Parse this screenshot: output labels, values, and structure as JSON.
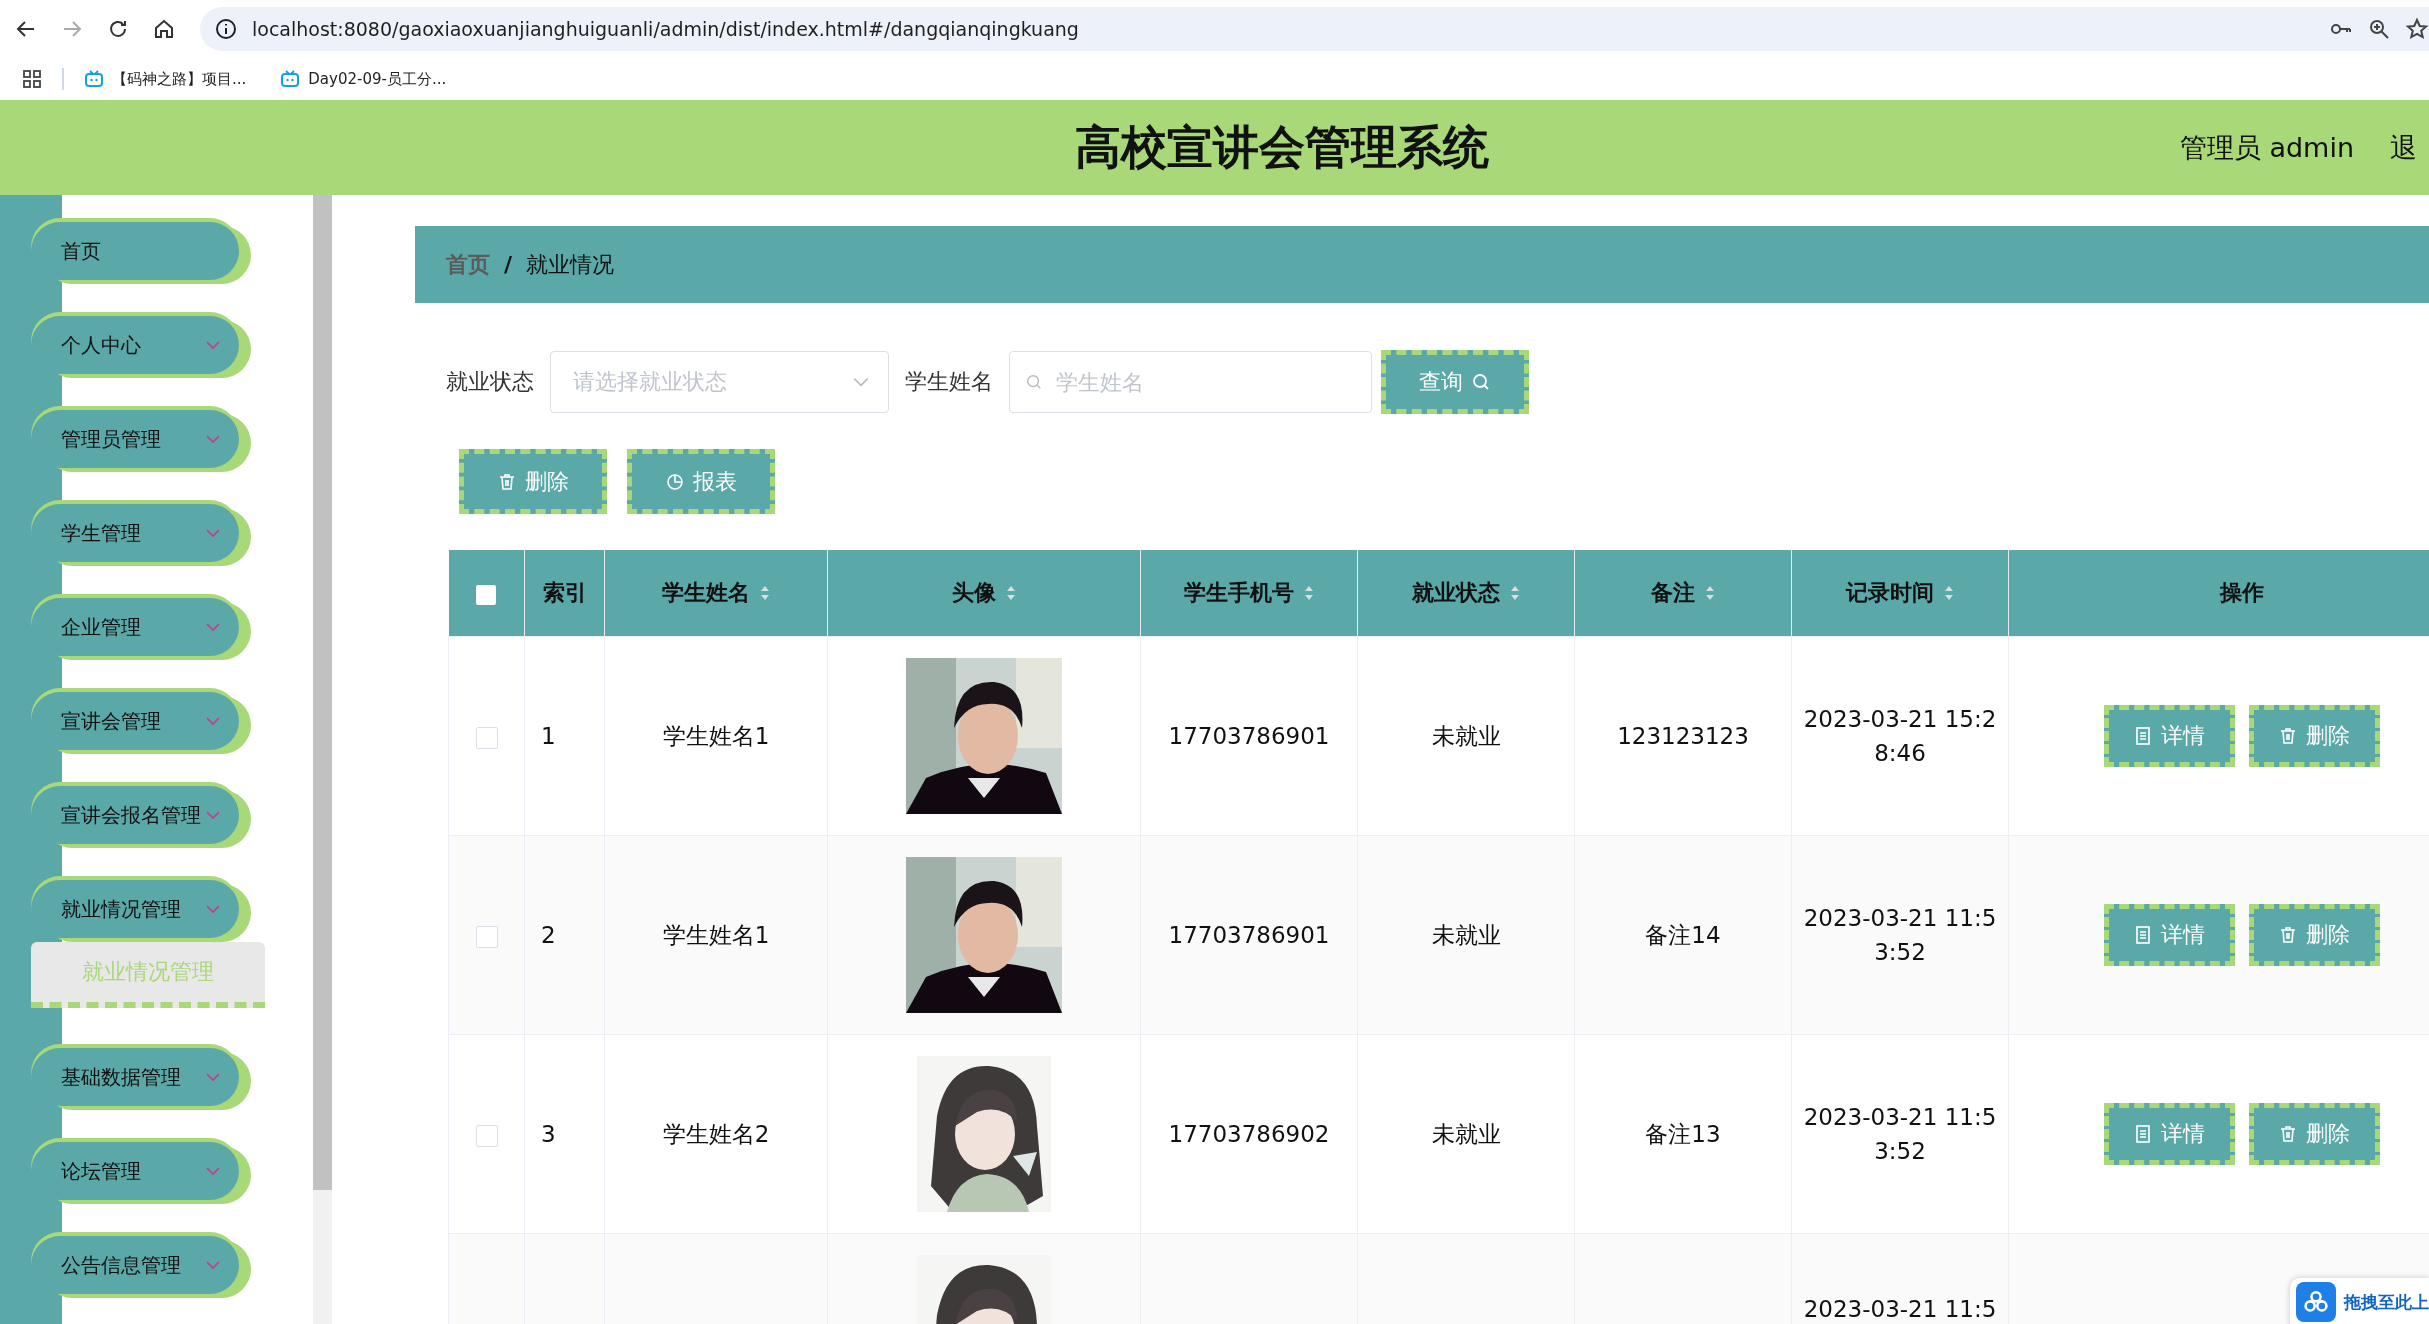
{
  "browser": {
    "url": "localhost:8080/gaoxiaoxuanjianghuiguanli/admin/dist/index.html#/dangqianqingkuang",
    "bookmarks": [
      "【码神之路】项目...",
      "Day02-09-员工分..."
    ]
  },
  "header": {
    "title": "高校宣讲会管理系统",
    "user": "管理员 admin",
    "logout": "退"
  },
  "sidebar": {
    "items": [
      {
        "label": "首页",
        "kind": "link"
      },
      {
        "label": "个人中心",
        "kind": "group"
      },
      {
        "label": "管理员管理",
        "kind": "group"
      },
      {
        "label": "学生管理",
        "kind": "group"
      },
      {
        "label": "企业管理",
        "kind": "group"
      },
      {
        "label": "宣讲会管理",
        "kind": "group"
      },
      {
        "label": "宣讲会报名管理",
        "kind": "group"
      },
      {
        "label": "就业情况管理",
        "kind": "group",
        "children": [
          {
            "label": "就业情况管理",
            "selected": true
          }
        ]
      },
      {
        "label": "基础数据管理",
        "kind": "group"
      },
      {
        "label": "论坛管理",
        "kind": "group"
      },
      {
        "label": "公告信息管理",
        "kind": "group"
      }
    ]
  },
  "breadcrumb": {
    "items": [
      {
        "label": "首页",
        "kind": "link"
      },
      {
        "label": "就业情况",
        "kind": "current"
      }
    ],
    "separator": "/"
  },
  "search": {
    "fields": [
      {
        "label": "就业状态",
        "kind": "select",
        "placeholder": "请选择就业状态"
      },
      {
        "label": "学生姓名",
        "kind": "text",
        "placeholder": "学生姓名"
      }
    ],
    "button": "查询"
  },
  "actions": [
    {
      "label": "删除",
      "kind": "delete"
    },
    {
      "label": "报表",
      "kind": "report"
    }
  ],
  "table": {
    "select_all": {
      "checked": false
    },
    "columns": [
      {
        "label": "索引",
        "sortable": false
      },
      {
        "label": "学生姓名",
        "sortable": true
      },
      {
        "label": "头像",
        "sortable": true
      },
      {
        "label": "学生手机号",
        "sortable": true
      },
      {
        "label": "就业状态",
        "sortable": true
      },
      {
        "label": "备注",
        "sortable": true
      },
      {
        "label": "记录时间",
        "sortable": true
      },
      {
        "label": "操作",
        "sortable": false
      }
    ],
    "rows": [
      {
        "index": "1",
        "name": "学生姓名1",
        "phone": "17703786901",
        "status": "未就业",
        "remark": "123123123",
        "time": "2023-03-21 15:28:46",
        "checked": false,
        "actions": [
          {
            "label": "详情",
            "kind": "detail"
          },
          {
            "label": "删除",
            "kind": "delete"
          }
        ]
      },
      {
        "index": "2",
        "name": "学生姓名1",
        "phone": "17703786901",
        "status": "未就业",
        "remark": "备注14",
        "time": "2023-03-21 11:53:52",
        "checked": false,
        "actions": [
          {
            "label": "详情",
            "kind": "detail"
          },
          {
            "label": "删除",
            "kind": "delete"
          }
        ]
      },
      {
        "index": "3",
        "name": "学生姓名2",
        "phone": "17703786902",
        "status": "未就业",
        "remark": "备注13",
        "time": "2023-03-21 11:53:52",
        "checked": false,
        "actions": [
          {
            "label": "详情",
            "kind": "detail"
          },
          {
            "label": "删除",
            "kind": "delete"
          }
        ]
      },
      {
        "time": "2023-03-21 11:5"
      }
    ]
  },
  "upload_hint": "拖拽至此上"
}
